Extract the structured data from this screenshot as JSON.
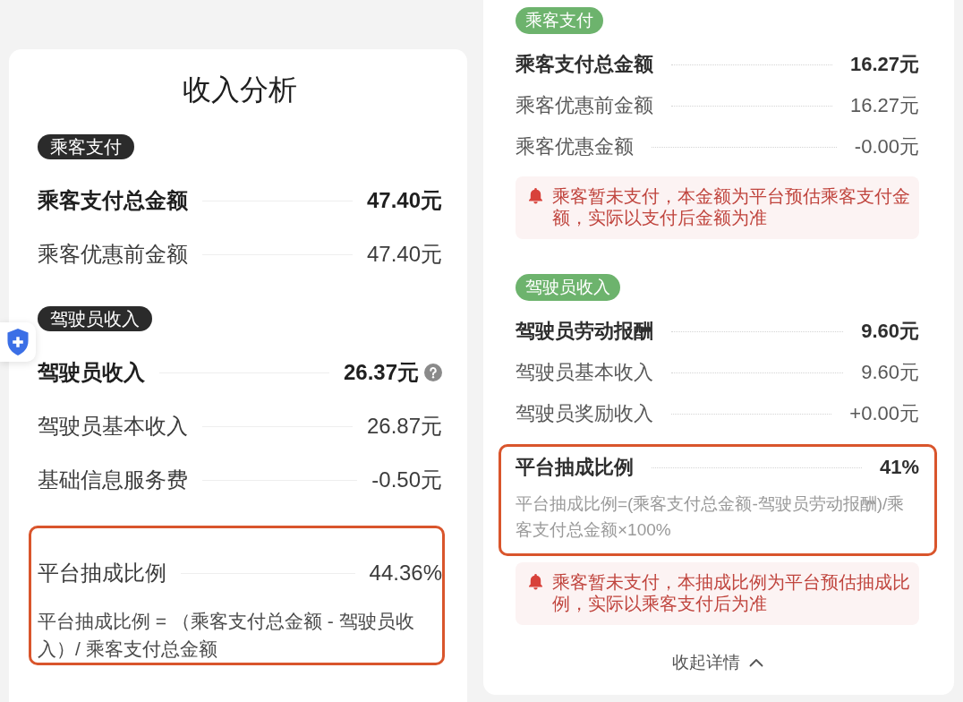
{
  "panels": [
    {
      "kind": "dark",
      "title": "收入分析",
      "floating_button": {
        "kind": "shield"
      },
      "sections": [
        {
          "tag": "乘客支付",
          "highlighted": false,
          "rows": [
            {
              "label": "乘客支付总金额",
              "value": "47.40元",
              "bold": true
            },
            {
              "label": "乘客优惠前金额",
              "value": "47.40元",
              "bold": false
            }
          ]
        },
        {
          "tag": "驾驶员收入",
          "highlighted": false,
          "rows": [
            {
              "label": "驾驶员收入",
              "value": "26.37元",
              "bold": true,
              "help": true
            },
            {
              "label": "驾驶员基本收入",
              "value": "26.87元",
              "bold": false
            },
            {
              "label": "基础信息服务费",
              "value": "-0.50元",
              "bold": false
            }
          ]
        },
        {
          "highlighted": true,
          "rows": [
            {
              "label": "平台抽成比例",
              "value": "44.36%",
              "bold": false
            }
          ],
          "formula": "平台抽成比例 = （乘客支付总金额 - 驾驶员收入）/ 乘客支付总金额"
        }
      ]
    },
    {
      "kind": "green",
      "sections": [
        {
          "tag": "乘客支付",
          "highlighted": false,
          "rows": [
            {
              "label": "乘客支付总金额",
              "value": "16.27元",
              "bold": true
            },
            {
              "label": "乘客优惠前金额",
              "value": "16.27元",
              "bold": false
            },
            {
              "label": "乘客优惠金额",
              "value": "-0.00元",
              "bold": false
            }
          ],
          "notice": "乘客暂未支付，本金额为平台预估乘客支付金额，实际以支付后金额为准"
        },
        {
          "tag": "驾驶员收入",
          "highlighted": false,
          "rows": [
            {
              "label": "驾驶员劳动报酬",
              "value": "9.60元",
              "bold": true
            },
            {
              "label": "驾驶员基本收入",
              "value": "9.60元",
              "bold": false
            },
            {
              "label": "驾驶员奖励收入",
              "value": "+0.00元",
              "bold": false
            }
          ]
        },
        {
          "highlighted": true,
          "rows": [
            {
              "label": "平台抽成比例",
              "value": "41%",
              "bold": true
            }
          ],
          "formula": "平台抽成比例=(乘客支付总金额-驾驶员劳动报酬)/乘客支付总金额×100%",
          "notice": "乘客暂未支付，本抽成比例为平台预估抽成比例，实际以乘客支付后为准"
        }
      ],
      "footer_link": "收起详情"
    }
  ]
}
